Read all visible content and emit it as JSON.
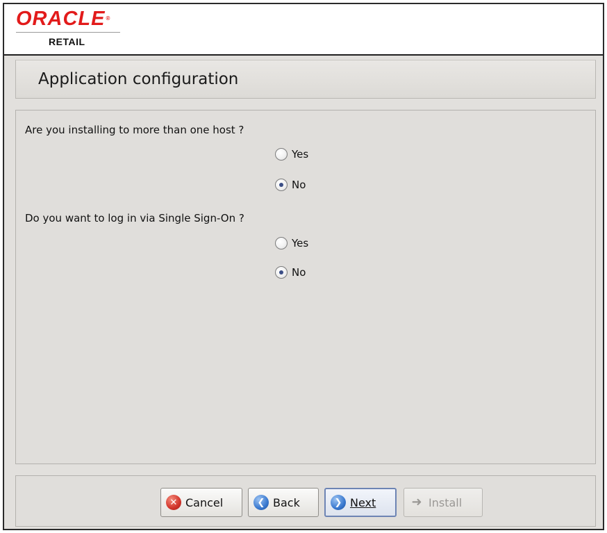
{
  "brand": {
    "logo_text": "ORACLE",
    "logo_subtext": "RETAIL"
  },
  "page": {
    "title": "Application configuration"
  },
  "questions": [
    {
      "text": "Are you installing to more than one host ?",
      "options": [
        {
          "label": "Yes",
          "selected": false
        },
        {
          "label": "No",
          "selected": true
        }
      ]
    },
    {
      "text": "Do you want to log in via Single Sign-On ?",
      "options": [
        {
          "label": "Yes",
          "selected": false
        },
        {
          "label": "No",
          "selected": true
        }
      ]
    }
  ],
  "buttons": {
    "cancel": {
      "label": "Cancel",
      "icon": "cancel-icon",
      "enabled": true
    },
    "back": {
      "label": "Back",
      "icon": "back-arrow-icon",
      "enabled": true
    },
    "next": {
      "label": "Next",
      "icon": "next-arrow-icon",
      "enabled": true,
      "focused": true
    },
    "install": {
      "label": "Install",
      "icon": "install-arrow-icon",
      "enabled": false
    }
  },
  "colors": {
    "brand_red": "#e21b1b",
    "panel_bg": "#e0dedb",
    "radio_dot": "#3b4e86",
    "focus_border": "#6d84b4"
  }
}
